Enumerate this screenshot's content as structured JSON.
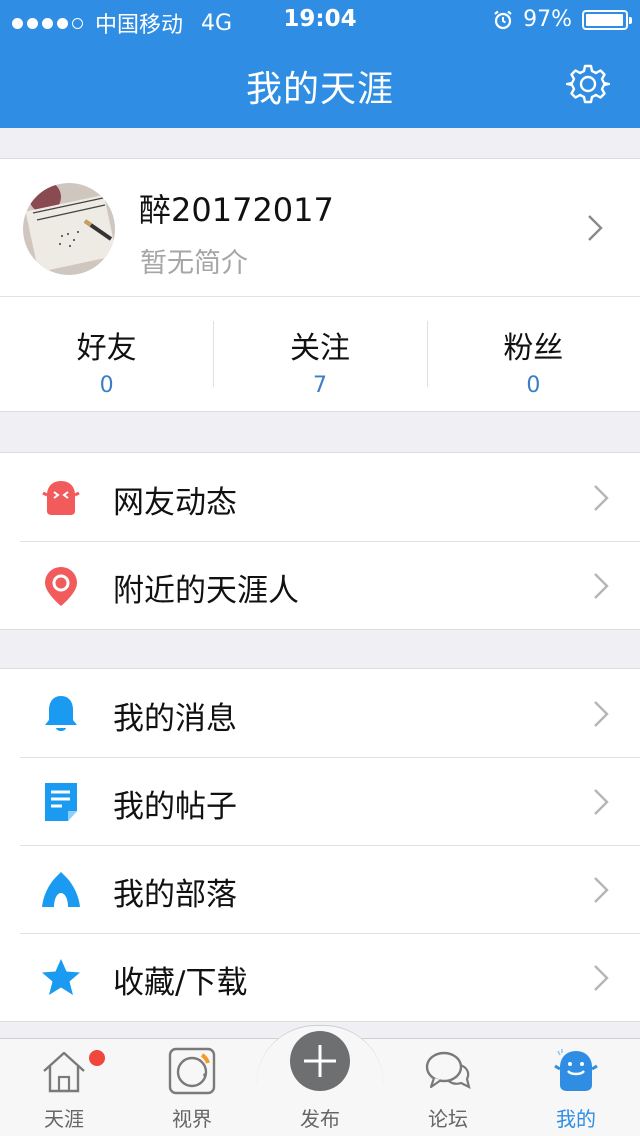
{
  "status_bar": {
    "carrier": "中国移动",
    "network": "4G",
    "time": "19:04",
    "battery": "97%"
  },
  "nav": {
    "title": "我的天涯"
  },
  "profile": {
    "name": "醉20172017",
    "bio": "暂无简介"
  },
  "stats": [
    {
      "label": "好友",
      "value": "0"
    },
    {
      "label": "关注",
      "value": "7"
    },
    {
      "label": "粉丝",
      "value": "0"
    }
  ],
  "menu_group_1": [
    {
      "label": "网友动态",
      "icon": "friend-activity-icon"
    },
    {
      "label": "附近的天涯人",
      "icon": "location-pin-icon"
    }
  ],
  "menu_group_2": [
    {
      "label": "我的消息",
      "icon": "bell-icon"
    },
    {
      "label": "我的帖子",
      "icon": "document-icon"
    },
    {
      "label": "我的部落",
      "icon": "tent-icon"
    },
    {
      "label": "收藏/下载",
      "icon": "star-icon"
    }
  ],
  "tabs": [
    {
      "label": "天涯",
      "icon": "home-icon"
    },
    {
      "label": "视界",
      "icon": "camera-icon"
    },
    {
      "label": "发布",
      "icon": "plus-icon"
    },
    {
      "label": "论坛",
      "icon": "chat-bubbles-icon"
    },
    {
      "label": "我的",
      "icon": "mascot-icon"
    }
  ],
  "colors": {
    "primary": "#2f8ee3",
    "red_icon": "#f25b5b",
    "blue_icon": "#1a9af0",
    "badge": "#f0463c"
  }
}
